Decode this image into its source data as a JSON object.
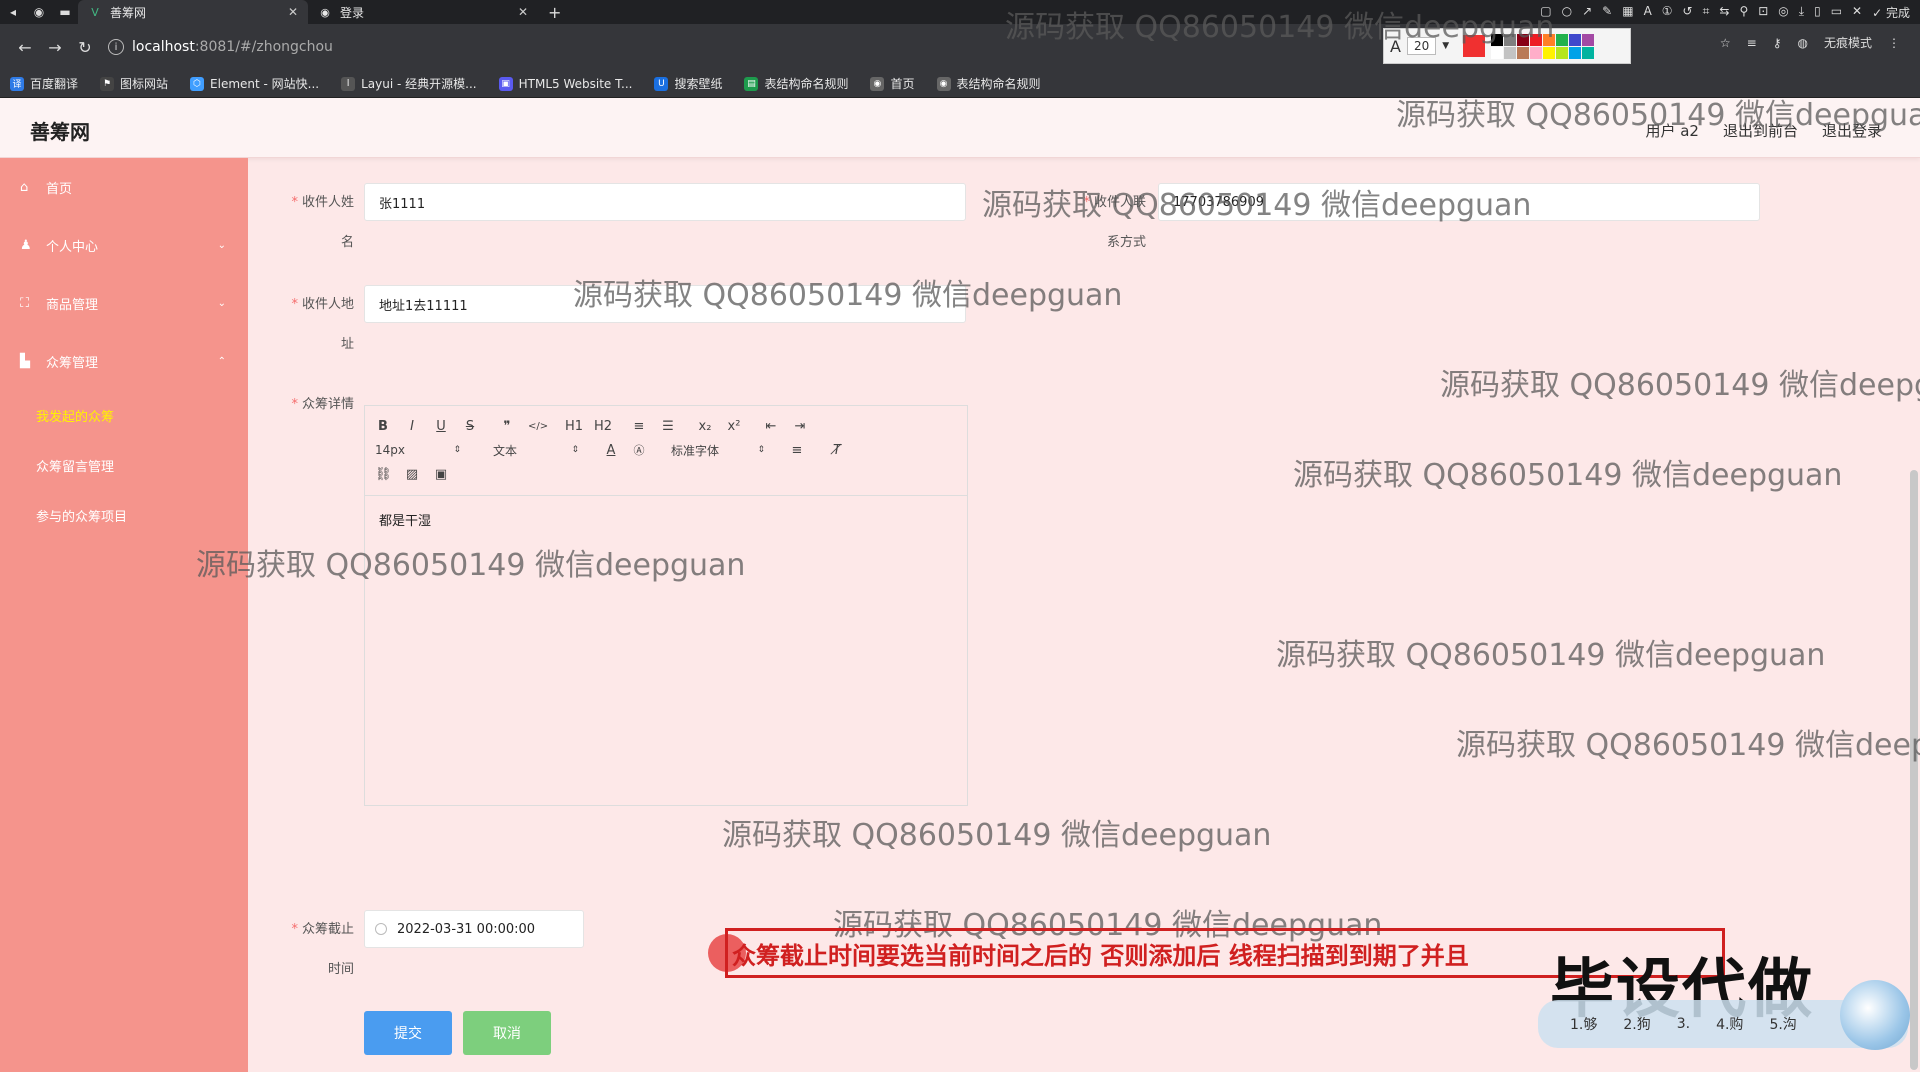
{
  "browser": {
    "tabs": [
      {
        "title": "善筹网",
        "active": true
      },
      {
        "title": "登录",
        "active": false
      }
    ],
    "url_host": "localhost",
    "url_path": ":8081/#/zhongchou",
    "bookmarks": [
      "百度翻译",
      "图标网站",
      "Element - 网站快...",
      "Layui - 经典开源模...",
      "HTML5 Website T...",
      "搜索壁纸",
      "表结构命名规则",
      "首页",
      "表结构命名规则"
    ],
    "incognito_label": "无痕模式",
    "done_label": "完成",
    "draw_font_size": "20"
  },
  "app": {
    "logo": "善筹网",
    "header_links": [
      "用户 a2",
      "退出到前台",
      "退出登录"
    ]
  },
  "sidebar": {
    "items": [
      {
        "label": "首页",
        "icon": "home-icon"
      },
      {
        "label": "个人中心",
        "icon": "user-icon"
      },
      {
        "label": "商品管理",
        "icon": "expand-icon"
      },
      {
        "label": "众筹管理",
        "icon": "chart-icon"
      }
    ],
    "sub_items": [
      {
        "label": "我发起的众筹",
        "active": true
      },
      {
        "label": "众筹留言管理",
        "active": false
      },
      {
        "label": "参与的众筹项目",
        "active": false
      }
    ]
  },
  "form": {
    "recipient_name_label_1": "收件人姓",
    "recipient_name_label_2": "名",
    "recipient_name_value": "张1111",
    "contact_label_1": "收件人联",
    "contact_label_2": "系方式",
    "contact_value": "17703786909",
    "address_label_1": "收件人地",
    "address_label_2": "址",
    "address_value": "地址1去11111",
    "detail_label": "众筹详情",
    "editor": {
      "row1": [
        "B",
        "I",
        "U",
        "S",
        "❞",
        "</>",
        "H1",
        "H2",
        "≡",
        "☰",
        "x₂",
        "x²",
        "⇤",
        "⇥"
      ],
      "font_size": "14px",
      "text_type": "文本",
      "font_family": "标准字体",
      "content": "都是干湿"
    },
    "deadline_label_1": "众筹截止",
    "deadline_label_2": "时间",
    "deadline_value": "2022-03-31 00:00:00",
    "submit_label": "提交",
    "cancel_label": "取消"
  },
  "overlay": {
    "watermark": "源码获取 QQ86050149 微信deepguan",
    "caption": "众筹截止时间要选当前时间之后的 否则添加后 线程扫描到到期了并且",
    "brand": "毕设代做",
    "ime_candidates": [
      "1.够",
      "2.狗",
      "3.",
      "4.购",
      "5.沟"
    ]
  }
}
